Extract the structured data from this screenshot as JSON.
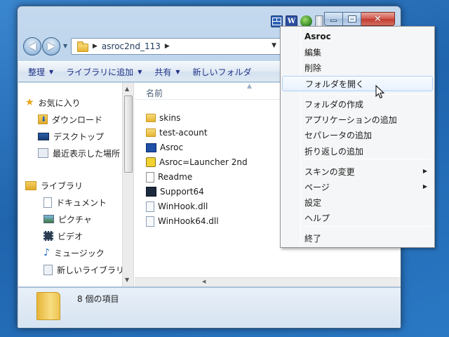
{
  "window": {
    "min_icon": "minimize-icon",
    "max_icon": "maximize-icon",
    "close_symbol": "✕"
  },
  "tray": {
    "icons": [
      "layout-icon",
      "word-icon",
      "globe-icon",
      "bin-icon"
    ]
  },
  "address": {
    "path": "asroc2nd_113"
  },
  "toolbar": {
    "organize": "整理",
    "add_library": "ライブラリに追加",
    "share": "共有",
    "new_folder": "新しいフォルダ"
  },
  "navpane": {
    "favorites": "お気に入り",
    "downloads": "ダウンロード",
    "desktop": "デスクトップ",
    "recent": "最近表示した場所",
    "libraries": "ライブラリ",
    "documents": "ドキュメント",
    "pictures": "ピクチャ",
    "videos": "ビデオ",
    "music": "ミュージック",
    "new_library": "新しいライブラリ"
  },
  "filepane": {
    "column_name": "名前",
    "files": [
      {
        "name": "skins",
        "icon": "folder-icon"
      },
      {
        "name": "test-acount",
        "icon": "folder-icon"
      },
      {
        "name": "Asroc",
        "icon": "app-icon"
      },
      {
        "name": "Asroc=Launcher 2nd",
        "icon": "shortcut-icon"
      },
      {
        "name": "Readme",
        "icon": "text-file-icon"
      },
      {
        "name": "Support64",
        "icon": "console-app-icon"
      },
      {
        "name": "WinHook.dll",
        "icon": "dll-icon"
      },
      {
        "name": "WinHook64.dll",
        "icon": "dll-icon"
      }
    ]
  },
  "status": {
    "count_text": "8 個の項目"
  },
  "context_menu": {
    "items": [
      {
        "label": "Asroc"
      },
      {
        "label": "編集"
      },
      {
        "label": "削除"
      },
      {
        "label": "フォルダを開く"
      },
      {
        "label": "フォルダの作成"
      },
      {
        "label": "アプリケーションの追加"
      },
      {
        "label": "セパレータの追加"
      },
      {
        "label": "折り返しの追加"
      },
      {
        "label": "スキンの変更"
      },
      {
        "label": "ページ"
      },
      {
        "label": "設定"
      },
      {
        "label": "ヘルプ"
      },
      {
        "label": "終了"
      }
    ],
    "hovered": "フォルダを開く"
  }
}
